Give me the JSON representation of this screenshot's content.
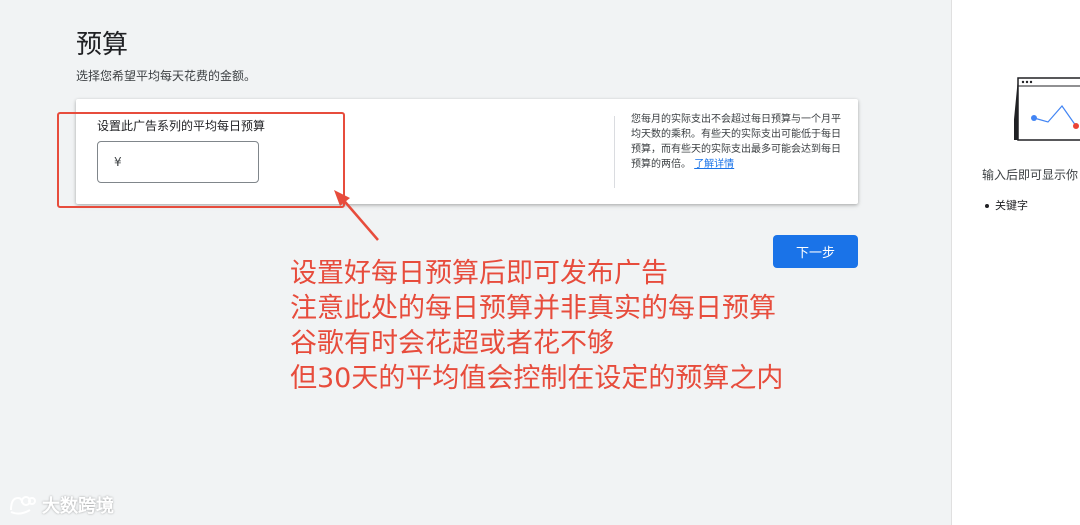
{
  "page": {
    "title": "预算",
    "subtitle": "选择您希望平均每天花费的金额。"
  },
  "budget_card": {
    "field_label": "设置此广告系列的平均每日预算",
    "currency_symbol": "¥",
    "input_value": "",
    "help_text": "您每月的实际支出不会超过每日预算与一个月平均天数的乘积。有些天的实际支出可能低于每日预算，而有些天的实际支出最多可能会达到每日预算的两倍。",
    "help_link": "了解详情"
  },
  "actions": {
    "next_label": "下一步"
  },
  "annotation": {
    "lines": [
      "设置好每日预算后即可发布广告",
      "注意此处的每日预算并非真实的每日预算",
      "谷歌有时会花超或者花不够",
      "但30天的平均值会控制在设定的预算之内"
    ],
    "color": "#e74c3c"
  },
  "side_panel": {
    "text": "输入后即可显示你",
    "bullets": [
      "关键字"
    ]
  },
  "watermark": {
    "text": "大数跨境"
  },
  "colors": {
    "primary": "#1a73e8",
    "annotation_red": "#e74c3c",
    "background": "#f1f3f4"
  }
}
